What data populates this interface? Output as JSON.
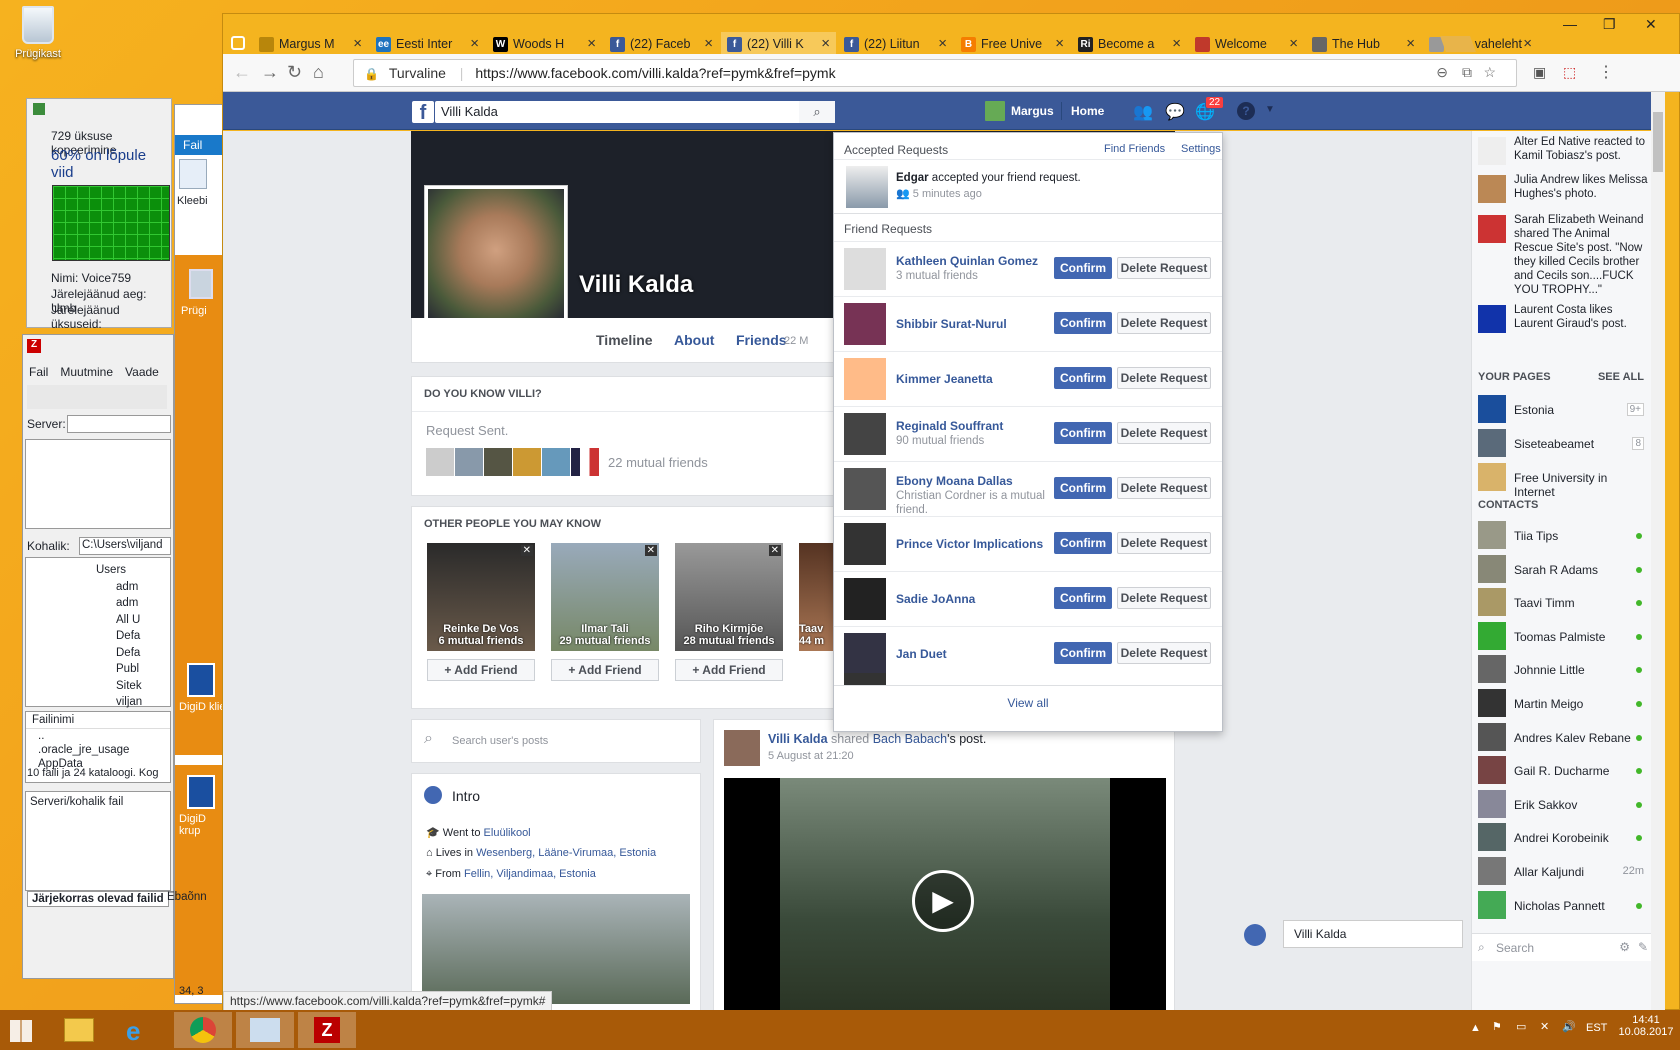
{
  "desktop": {
    "icon_label": "Prügikast",
    "copy": {
      "line1": "729 üksuse kopeerimine",
      "line2": "60% on lõpule viid",
      "name": "Nimi:  Voice759",
      "time_left": "Järelejäänud aeg:  Umb",
      "items_left": "Järelejäänud üksuseid:",
      "progress": 0.6
    },
    "ribbon": {
      "file_tab": "Fail",
      "paste": "Kleebi"
    },
    "filezilla": {
      "menu": [
        "Fail",
        "Muutmine",
        "Vaade"
      ],
      "server_label": "Server:",
      "local_label": "Kohalik:",
      "local_path": "C:\\Users\\viljand",
      "tree": [
        "Users",
        "adm",
        "adm",
        "All U",
        "Defa",
        "Defa",
        "Publ",
        "Sitek",
        "viljan"
      ],
      "col_filename": "Failinimi",
      "files": [
        "..",
        ".oracle_jre_usage",
        "AppData"
      ],
      "summary": "10 faili ja 24 kataloogi. Kog",
      "queue_header": "Serveri/kohalik fail",
      "tab_queued": "Järjekorras olevad failid",
      "tab_failed": "Ebaõnn"
    },
    "side_icons": [
      "Prügi",
      "DigiD klie",
      "DigiD krup"
    ],
    "coords": "34, 3"
  },
  "browser": {
    "tabs": [
      {
        "title": "Margus M",
        "fav": "",
        "color": "#b8860b"
      },
      {
        "title": "Eesti Inter",
        "fav": "ee",
        "color": "#1e73be"
      },
      {
        "title": "Woods H",
        "fav": "W",
        "color": "#000000"
      },
      {
        "title": "(22) Faceb",
        "fav": "f",
        "color": "#3b5998"
      },
      {
        "title": "(22) Villi K",
        "fav": "f",
        "color": "#3b5998"
      },
      {
        "title": "(22) Liitun",
        "fav": "f",
        "color": "#3b5998"
      },
      {
        "title": "Free Unive",
        "fav": "B",
        "color": "#f57d00"
      },
      {
        "title": "Become a",
        "fav": "Ri",
        "color": "#222222"
      },
      {
        "title": "Welcome",
        "fav": "",
        "color": "#c0392b"
      },
      {
        "title": "The Hub",
        "fav": "",
        "color": "#666666"
      },
      {
        "title": "Uus vaheleht",
        "fav": "",
        "color": "#999999"
      }
    ],
    "secure_label": "Turvaline",
    "url": "https://www.facebook.com/villi.kalda?ref=pymk&fref=pymk",
    "status_url": "https://www.facebook.com/villi.kalda?ref=pymk&fref=pymk#"
  },
  "fb": {
    "search_value": "Villi Kalda",
    "user": "Margus",
    "home": "Home",
    "notif_count": "22",
    "profile": {
      "name": "Villi Kalda",
      "tabs": [
        "Timeline",
        "About",
        "Friends"
      ],
      "friends_count": "22 M"
    },
    "dyk": {
      "header": "DO YOU KNOW VILLI?",
      "sent": "Request Sent.",
      "mutual": "22 mutual friends"
    },
    "pymk": {
      "header": "OTHER PEOPLE YOU MAY KNOW",
      "people": [
        {
          "name": "Reinke De Vos",
          "mutual": "6 mutual friends"
        },
        {
          "name": "Ilmar Tali",
          "mutual": "29 mutual friends"
        },
        {
          "name": "Riho Kirmjõe",
          "mutual": "28 mutual friends"
        },
        {
          "name": "Taav",
          "mutual": "44 m"
        }
      ],
      "add_label": "Add Friend"
    },
    "search_posts": "Search user's posts",
    "intro": {
      "title": "Intro",
      "went": "Went to",
      "school": "Eluülikool",
      "lives": "Lives in",
      "lives_place": "Wesenberg, Lääne-Virumaa, Estonia",
      "from": "From",
      "from_place": "Fellin, Viljandimaa, Estonia"
    },
    "post": {
      "author": "Villi Kalda",
      "shared": "shared",
      "who": "Bach Babach",
      "suffix": "'s post.",
      "time": "5 August at 21:20"
    },
    "requests": {
      "accepted_title": "Accepted Requests",
      "find_friends": "Find Friends",
      "settings": "Settings",
      "accepted_name": "Edgar",
      "accepted_text": "accepted your friend request.",
      "accepted_time": "5 minutes ago",
      "fr_title": "Friend Requests",
      "confirm": "Confirm",
      "delete": "Delete Request",
      "view_all": "View all",
      "items": [
        {
          "name": "Kathleen Quinlan Gomez",
          "mutual": "3 mutual friends"
        },
        {
          "name": "Shibbir Surat-Nurul",
          "mutual": ""
        },
        {
          "name": "Kimmer Jeanetta",
          "mutual": ""
        },
        {
          "name": "Reginald Souffrant",
          "mutual": "90 mutual friends"
        },
        {
          "name": "Ebony Moana Dallas",
          "mutual": "Christian Cordner is a mutual friend."
        },
        {
          "name": "Prince Victor Implications",
          "mutual": ""
        },
        {
          "name": "Sadie JoAnna",
          "mutual": ""
        },
        {
          "name": "Jan Duet",
          "mutual": ""
        }
      ]
    },
    "ticker": [
      {
        "text": "Alter Ed Native reacted to Kamil Tobiasz's post."
      },
      {
        "text": "Julia Andrew likes Melissa Hughes's photo."
      },
      {
        "text": "Sarah Elizabeth Weinand shared The Animal Rescue Site's post. \"Now they killed Cecils brother and Cecils son....FUCK YOU TROPHY...\""
      },
      {
        "text": "Laurent Costa likes Laurent Giraud's post."
      }
    ],
    "your_pages": "YOUR PAGES",
    "see_all": "SEE ALL",
    "pages": [
      {
        "name": "Estonia",
        "count": "9+"
      },
      {
        "name": "Siseteabeamet",
        "count": "8"
      },
      {
        "name": "Free University in Internet",
        "count": ""
      }
    ],
    "contacts_header": "CONTACTS",
    "contacts": [
      {
        "name": "Tiia Tips",
        "status": ""
      },
      {
        "name": "Sarah R Adams",
        "status": ""
      },
      {
        "name": "Taavi Timm",
        "status": ""
      },
      {
        "name": "Toomas Palmiste",
        "status": ""
      },
      {
        "name": "Johnnie Little",
        "status": ""
      },
      {
        "name": "Martin Meigo",
        "status": ""
      },
      {
        "name": "Andres Kalev Rebane",
        "status": ""
      },
      {
        "name": "Gail R. Ducharme",
        "status": ""
      },
      {
        "name": "Erik Sakkov",
        "status": ""
      },
      {
        "name": "Andrei Korobeinik",
        "status": ""
      },
      {
        "name": "Allar Kaljundi",
        "status": "22m"
      },
      {
        "name": "Nicholas Pannett",
        "status": ""
      }
    ],
    "chat_search": "Search",
    "chat_tab": "Villi Kalda"
  },
  "taskbar": {
    "lang": "EST",
    "time": "14:41",
    "date": "10.08.2017"
  }
}
